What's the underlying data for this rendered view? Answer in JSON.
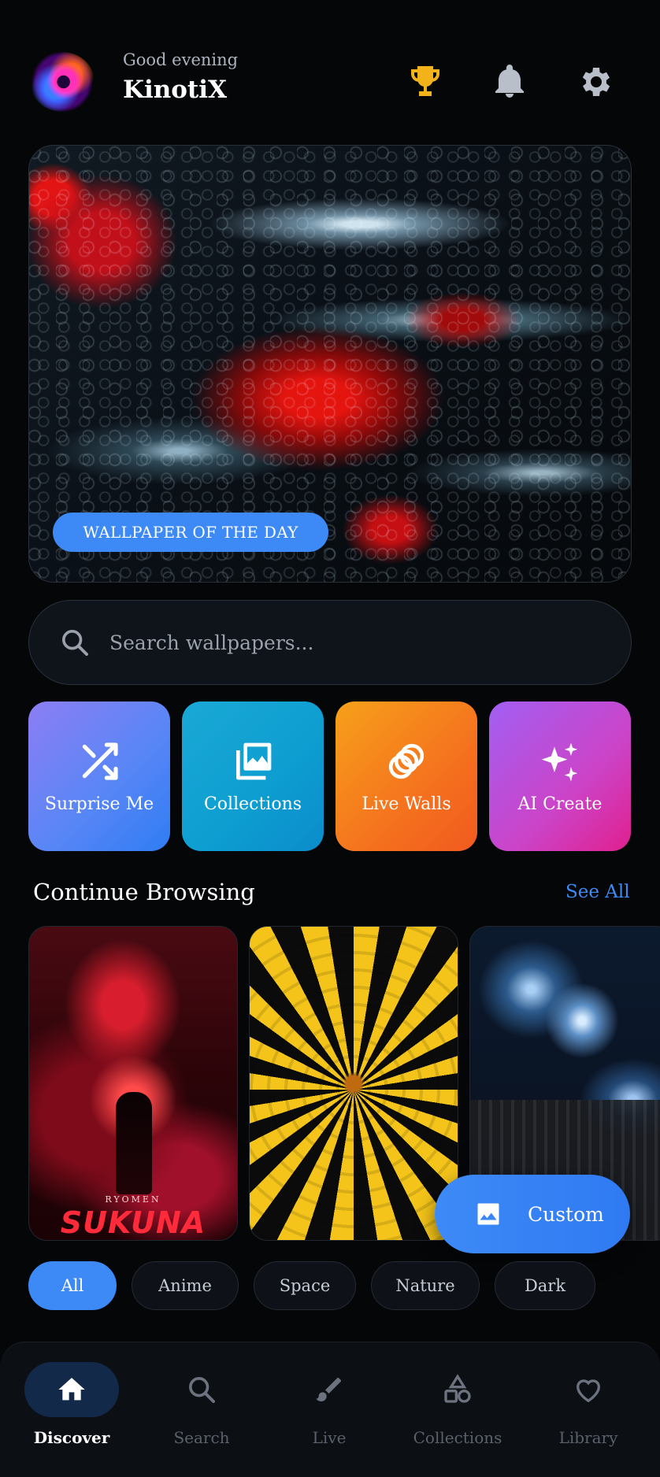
{
  "header": {
    "greeting": "Good evening",
    "username": "KinotiX",
    "icons": [
      "trophy-icon",
      "bell-icon",
      "gear-icon"
    ],
    "trophy_color": "#f4b21a"
  },
  "hero": {
    "badge": "WALLPAPER OF THE DAY"
  },
  "search": {
    "placeholder": "Search wallpapers..."
  },
  "quick_actions": [
    {
      "label": "Surprise Me",
      "icon": "shuffle-icon"
    },
    {
      "label": "Collections",
      "icon": "photo-library-icon"
    },
    {
      "label": "Live Walls",
      "icon": "rings-icon"
    },
    {
      "label": "AI Create",
      "icon": "sparkles-icon"
    }
  ],
  "continue_browsing": {
    "title": "Continue Browsing",
    "see_all": "See All",
    "cards": [
      {
        "subtitle": "RYOMEN",
        "title": "SUKUNA"
      },
      {
        "subtitle": "",
        "title": ""
      },
      {
        "subtitle": "",
        "title": ""
      }
    ]
  },
  "fab": {
    "label": "Custom",
    "icon": "image-icon"
  },
  "chips": [
    "All",
    "Anime",
    "Space",
    "Nature",
    "Dark"
  ],
  "active_chip": "All",
  "bottom_nav": [
    {
      "label": "Discover",
      "icon": "home-icon",
      "active": true
    },
    {
      "label": "Search",
      "icon": "search-icon",
      "active": false
    },
    {
      "label": "Live",
      "icon": "brush-icon",
      "active": false
    },
    {
      "label": "Collections",
      "icon": "shapes-icon",
      "active": false
    },
    {
      "label": "Library",
      "icon": "heart-icon",
      "active": false
    }
  ],
  "colors": {
    "accent": "#3d8af7",
    "background": "#050608"
  }
}
